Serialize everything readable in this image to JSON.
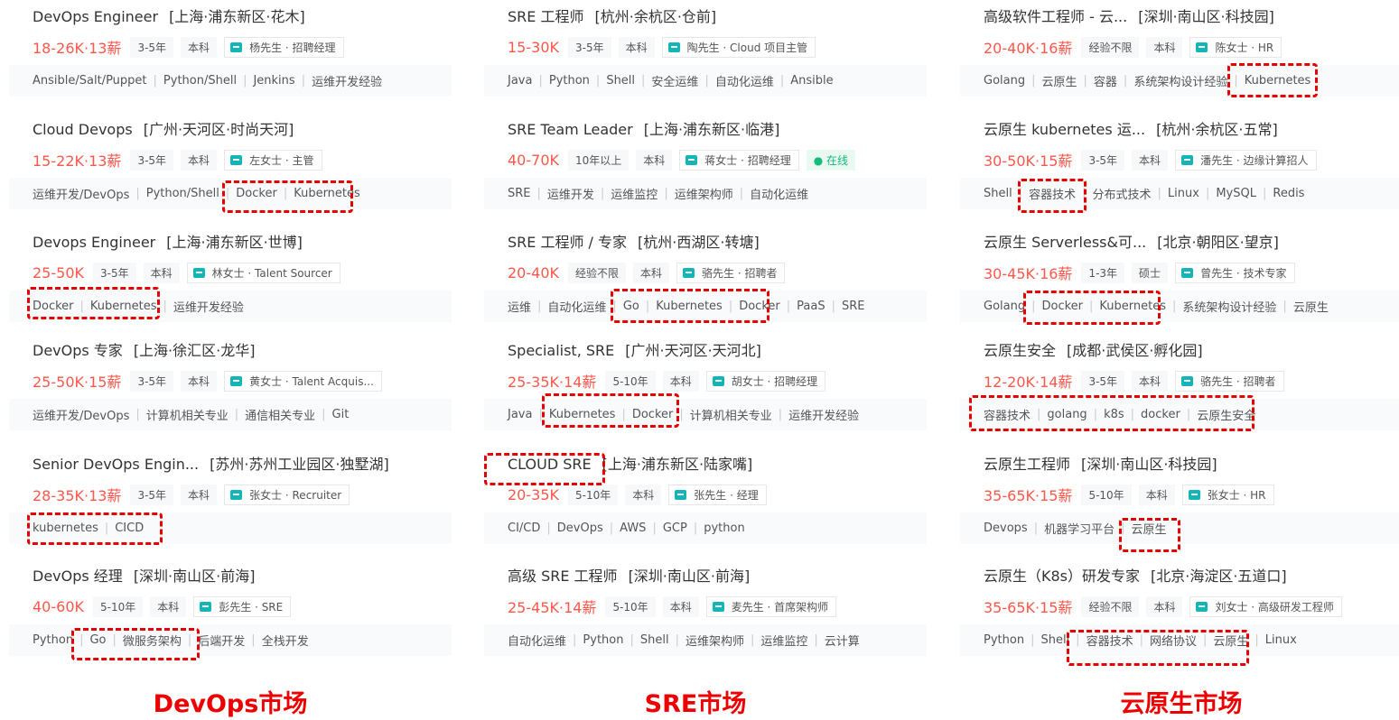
{
  "columns": [
    {
      "market": "DevOps市场",
      "jobs": [
        {
          "title": "DevOps Engineer",
          "location": "[上海·浦东新区·花木]",
          "salary": "18-26K·13薪",
          "tags": [
            "3-5年",
            "本科"
          ],
          "recruiter": "杨先生 · 招聘经理",
          "online": "",
          "skills": [
            "Ansible/Salt/Puppet",
            "Python/Shell",
            "Jenkins",
            "运维开发经验"
          ]
        },
        {
          "title": "Cloud Devops",
          "location": "[广州·天河区·时尚天河]",
          "salary": "15-22K·13薪",
          "tags": [
            "3-5年",
            "本科"
          ],
          "recruiter": "左女士 · 主管",
          "online": "",
          "skills": [
            "运维开发/DevOps",
            "Python/Shell",
            "Docker",
            "Kubernetes"
          ]
        },
        {
          "title": "Devops Engineer",
          "location": "[上海·浦东新区·世博]",
          "salary": "25-50K",
          "tags": [
            "3-5年",
            "本科"
          ],
          "recruiter": "林女士 · Talent Sourcer",
          "online": "",
          "skills": [
            "Docker",
            "Kubernetes",
            "运维开发经验"
          ]
        },
        {
          "title": "DevOps 专家",
          "location": "[上海·徐汇区·龙华]",
          "salary": "25-50K·15薪",
          "tags": [
            "3-5年",
            "本科"
          ],
          "recruiter": "黄女士 · Talent Acquis...",
          "online": "",
          "skills": [
            "运维开发/DevOps",
            "计算机相关专业",
            "通信相关专业",
            "Git"
          ]
        },
        {
          "title": "Senior DevOps Engin...",
          "location": "[苏州·苏州工业园区·独墅湖]",
          "salary": "28-35K·13薪",
          "tags": [
            "3-5年",
            "本科"
          ],
          "recruiter": "张女士 · Recruiter",
          "online": "",
          "skills": [
            "kubernetes",
            "CICD"
          ]
        },
        {
          "title": "DevOps 经理",
          "location": "[深圳·南山区·前海]",
          "salary": "40-60K",
          "tags": [
            "5-10年",
            "本科"
          ],
          "recruiter": "彭先生 · SRE",
          "online": "",
          "skills": [
            "Python",
            "Go",
            "微服务架构",
            "后端开发",
            "全栈开发"
          ]
        }
      ]
    },
    {
      "market": "SRE市场",
      "jobs": [
        {
          "title": "SRE 工程师",
          "location": "[杭州·余杭区·仓前]",
          "salary": "15-30K",
          "tags": [
            "3-5年",
            "本科"
          ],
          "recruiter": "陶先生 · Cloud 项目主管",
          "online": "",
          "skills": [
            "Java",
            "Python",
            "Shell",
            "安全运维",
            "自动化运维",
            "Ansible"
          ]
        },
        {
          "title": "SRE Team Leader",
          "location": "[上海·浦东新区·临港]",
          "salary": "40-70K",
          "tags": [
            "10年以上",
            "本科"
          ],
          "recruiter": "蒋女士 · 招聘经理",
          "online": "● 在线",
          "skills": [
            "SRE",
            "运维开发",
            "运维监控",
            "运维架构师",
            "自动化运维"
          ]
        },
        {
          "title": "SRE 工程师 / 专家",
          "location": "[杭州·西湖区·转塘]",
          "salary": "20-40K",
          "tags": [
            "经验不限",
            "本科"
          ],
          "recruiter": "骆先生 · 招聘者",
          "online": "",
          "skills": [
            "运维",
            "自动化运维",
            "Go",
            "Kubernetes",
            "Docker",
            "PaaS",
            "SRE"
          ]
        },
        {
          "title": "Specialist, SRE",
          "location": "[广州·天河区·天河北]",
          "salary": "25-35K·14薪",
          "tags": [
            "5-10年",
            "本科"
          ],
          "recruiter": "胡女士 · 招聘经理",
          "online": "",
          "skills": [
            "Java",
            "Kubernetes",
            "Docker",
            "计算机相关专业",
            "运维开发经验"
          ]
        },
        {
          "title": "CLOUD SRE",
          "location": "[上海·浦东新区·陆家嘴]",
          "salary": "20-35K",
          "tags": [
            "5-10年",
            "本科"
          ],
          "recruiter": "张先生 · 经理",
          "online": "",
          "skills": [
            "CI/CD",
            "DevOps",
            "AWS",
            "GCP",
            "python"
          ]
        },
        {
          "title": "高级 SRE 工程师",
          "location": "[深圳·南山区·前海]",
          "salary": "25-45K·14薪",
          "tags": [
            "5-10年",
            "本科"
          ],
          "recruiter": "麦先生 · 首席架构师",
          "online": "",
          "skills": [
            "自动化运维",
            "Python",
            "Shell",
            "运维架构师",
            "运维监控",
            "云计算"
          ]
        }
      ]
    },
    {
      "market": "云原生市场",
      "jobs": [
        {
          "title": "高级软件工程师 - 云...",
          "location": "[深圳·南山区·科技园]",
          "salary": "20-40K·16薪",
          "tags": [
            "经验不限",
            "本科"
          ],
          "recruiter": "陈女士 · HR",
          "online": "",
          "skills": [
            "Golang",
            "云原生",
            "容器",
            "系统架构设计经验",
            "Kubernetes"
          ]
        },
        {
          "title": "云原生 kubernetes 运...",
          "location": "[杭州·余杭区·五常]",
          "salary": "30-50K·15薪",
          "tags": [
            "3-5年",
            "本科"
          ],
          "recruiter": "潘先生 · 边缘计算招人",
          "online": "",
          "skills": [
            "Shell",
            "容器技术",
            "分布式技术",
            "Linux",
            "MySQL",
            "Redis"
          ]
        },
        {
          "title": "云原生 Serverless&可...",
          "location": "[北京·朝阳区·望京]",
          "salary": "30-45K·16薪",
          "tags": [
            "1-3年",
            "硕士"
          ],
          "recruiter": "曾先生 · 技术专家",
          "online": "",
          "skills": [
            "Golang",
            "Docker",
            "Kubernetes",
            "系统架构设计经验",
            "云原生"
          ]
        },
        {
          "title": "云原生安全",
          "location": "[成都·武侯区·孵化园]",
          "salary": "12-20K·14薪",
          "tags": [
            "3-5年",
            "本科"
          ],
          "recruiter": "骆先生 · 招聘者",
          "online": "",
          "skills": [
            "容器技术",
            "golang",
            "k8s",
            "docker",
            "云原生安全"
          ]
        },
        {
          "title": "云原生工程师",
          "location": "[深圳·南山区·科技园]",
          "salary": "35-65K·15薪",
          "tags": [
            "5-10年",
            "本科"
          ],
          "recruiter": "张女士 · HR",
          "online": "",
          "skills": [
            "Devops",
            "机器学习平台",
            "云原生"
          ]
        },
        {
          "title": "云原生（K8s）研发专家",
          "location": "[北京·海淀区·五道口]",
          "salary": "35-65K·15薪",
          "tags": [
            "经验不限",
            "本科"
          ],
          "recruiter": "刘女士 · 高级研发工程师",
          "online": "",
          "skills": [
            "Python",
            "Shell",
            "容器技术",
            "网络协议",
            "云原生",
            "Linux"
          ]
        }
      ]
    }
  ]
}
